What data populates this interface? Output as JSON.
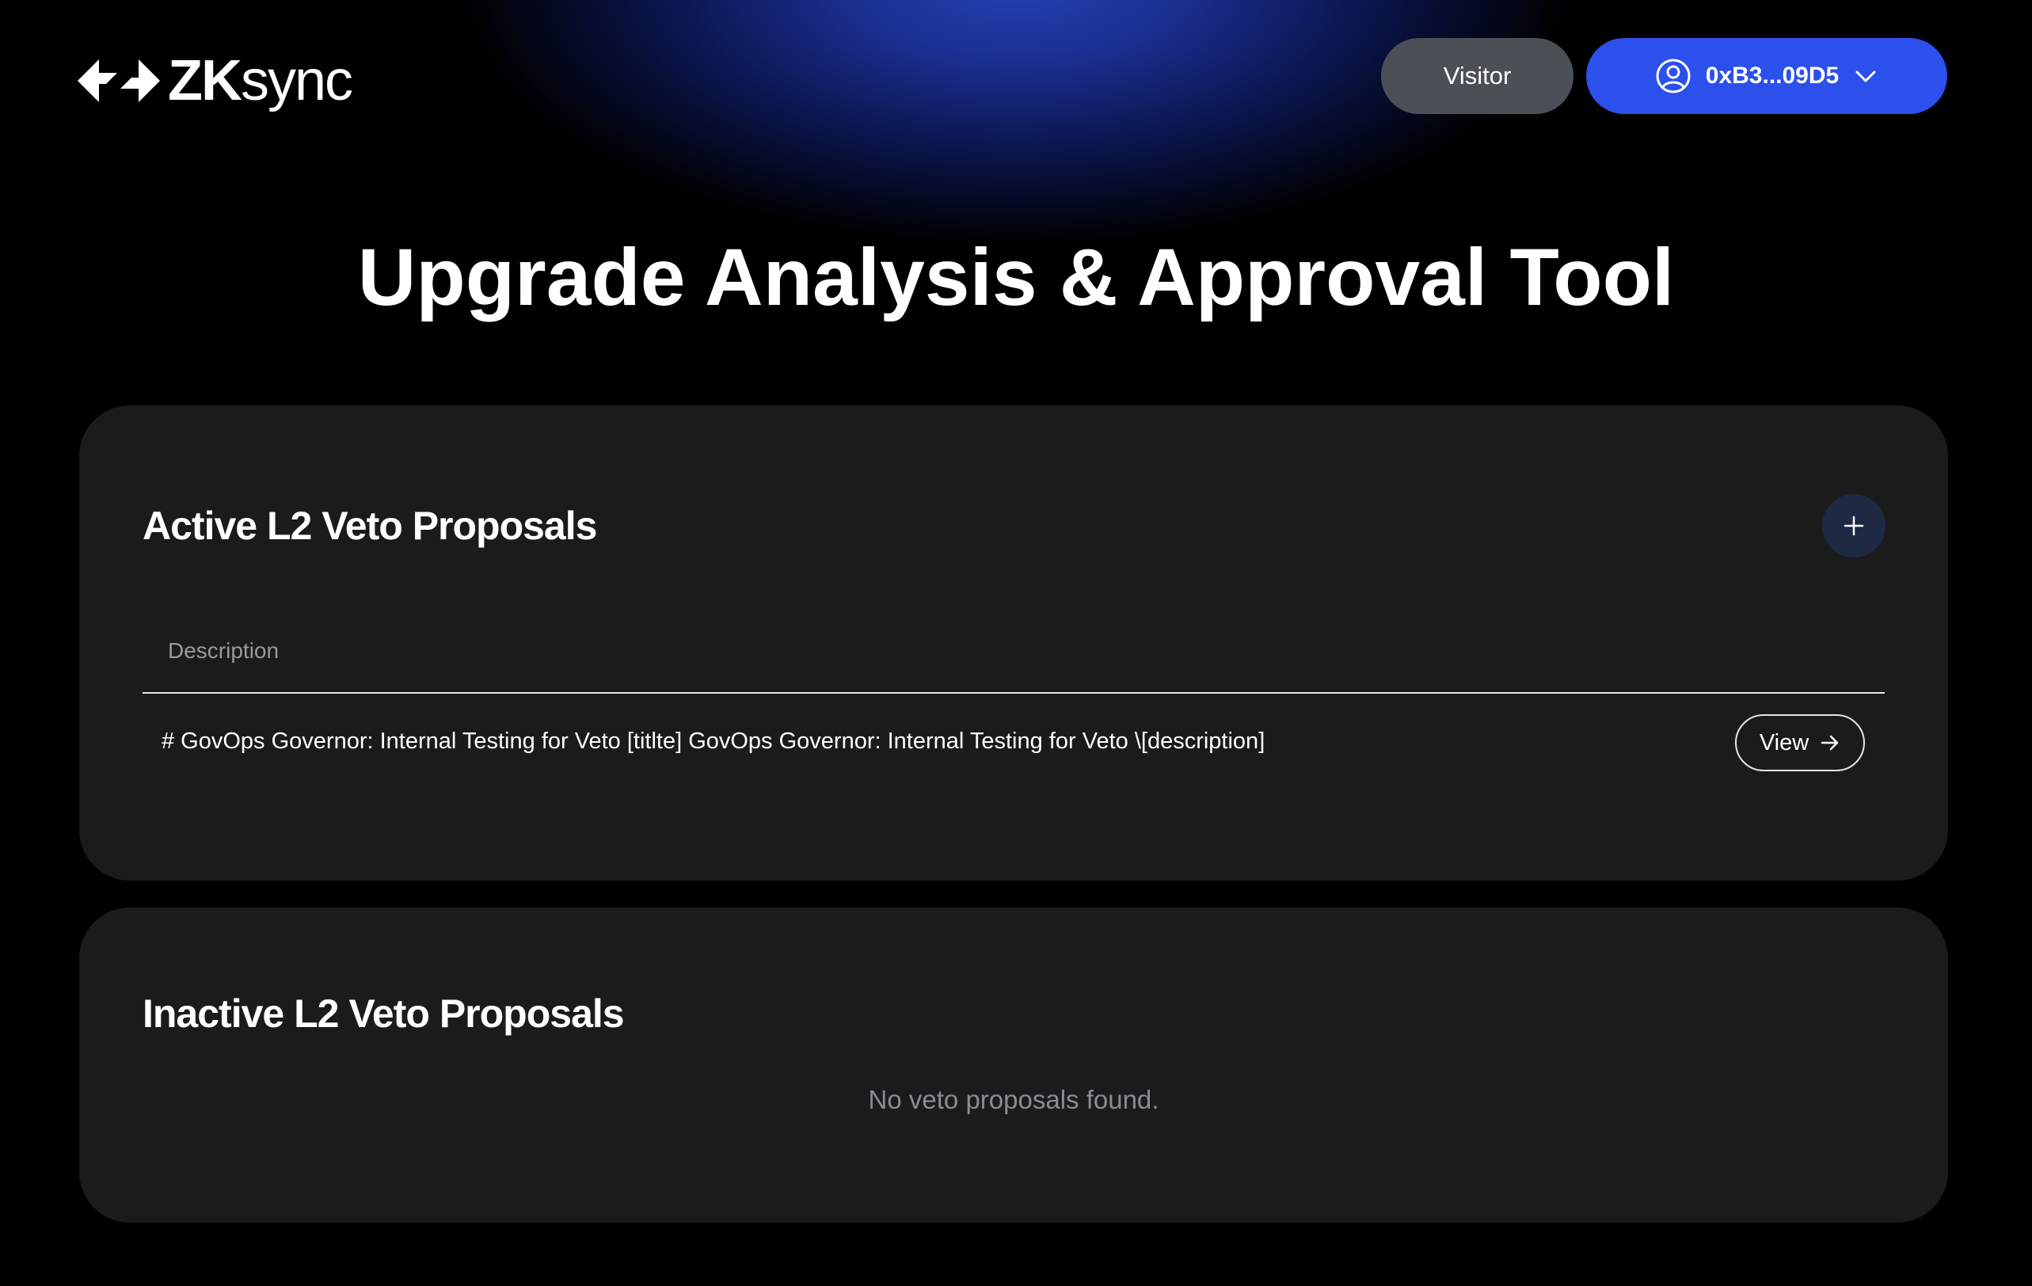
{
  "header": {
    "logo": {
      "bold": "ZK",
      "regular": "sync"
    },
    "visitor_label": "Visitor",
    "wallet": {
      "address": "0xB3...09D5"
    }
  },
  "page_title": "Upgrade Analysis & Approval Tool",
  "active": {
    "title": "Active L2 Veto Proposals",
    "columns": [
      "Description"
    ],
    "rows": [
      {
        "description": "# GovOps Governor: Internal Testing for Veto [titlte] GovOps Governor: Internal Testing for Veto \\[description]",
        "action_label": "View"
      }
    ]
  },
  "inactive": {
    "title": "Inactive L2 Veto Proposals",
    "empty_message": "No veto proposals found."
  },
  "colors": {
    "background": "#000000",
    "card": "#1b1b1b",
    "accent_blue": "#2b50ec",
    "visitor_gray": "#4b5057"
  },
  "icons": [
    "zksync-logo-icon",
    "user-circle-icon",
    "chevron-down-icon",
    "plus-icon",
    "arrow-right-icon"
  ]
}
